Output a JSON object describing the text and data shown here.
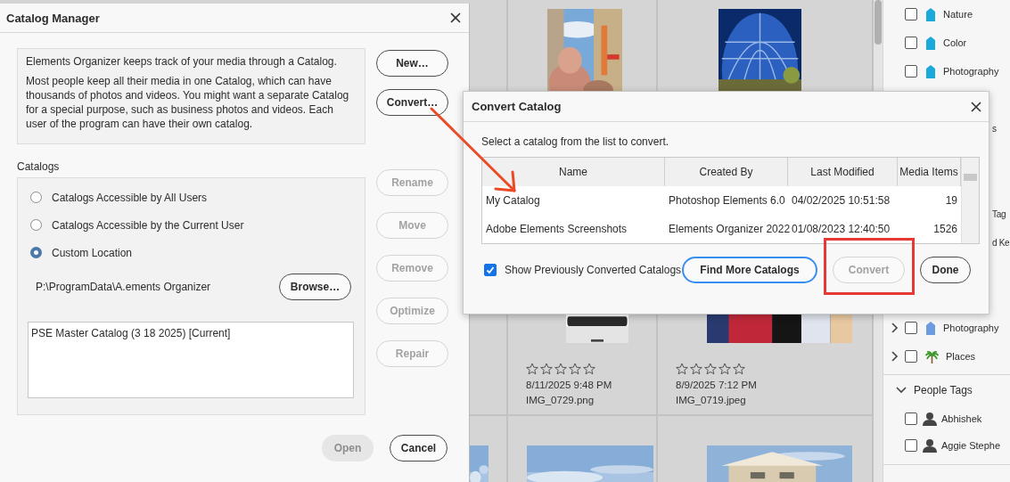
{
  "catalog_manager": {
    "title": "Catalog Manager",
    "intro": [
      "Elements Organizer keeps track of your media through a Catalog.",
      "Most people keep all their media in one Catalog, which can have thousands of photos and videos. You might want a separate Catalog for a special purpose, such as business photos and videos. Each user of the program can have their own catalog."
    ],
    "top_buttons": [
      {
        "label": "New…",
        "disabled": false
      },
      {
        "label": "Convert…",
        "disabled": false
      }
    ],
    "catalogs_label": "Catalogs",
    "locations": [
      {
        "label": "Catalogs Accessible by All Users",
        "selected": false
      },
      {
        "label": "Catalogs Accessible by the Current User",
        "selected": false
      },
      {
        "label": "Custom Location",
        "selected": true
      }
    ],
    "path": "P:\\ProgramData\\A.ements Organizer",
    "browse_button": "Browse…",
    "catalog_list": [
      "PSE Master Catalog (3 18 2025) [Current]"
    ],
    "catalog_buttons": [
      {
        "label": "Rename",
        "disabled": true
      },
      {
        "label": "Move",
        "disabled": true
      },
      {
        "label": "Remove",
        "disabled": true
      },
      {
        "label": "Optimize",
        "disabled": true
      },
      {
        "label": "Repair",
        "disabled": true
      }
    ],
    "footer_buttons": [
      {
        "label": "Open",
        "kind": "fill",
        "disabled": true
      },
      {
        "label": "Cancel",
        "kind": "outline",
        "disabled": false
      }
    ]
  },
  "media_grid": {
    "rows": [
      [
        {
          "thumbnail": {
            "kind": "picture"
          }
        },
        {
          "thumbnail": {
            "kind": "picture"
          }
        }
      ],
      [
        {
          "thumbnail": {
            "kind": "picture"
          },
          "stars": 0,
          "date": "8/11/2025 9:48 PM",
          "filename": "IMG_0729.png"
        },
        {
          "thumbnail": {
            "kind": "picture"
          },
          "stars": 0,
          "date": "8/9/2025 7:12 PM",
          "filename": "IMG_0719.jpeg"
        }
      ],
      [
        {
          "thumbnail": {
            "kind": "picture"
          }
        },
        {
          "thumbnail": {
            "kind": "picture"
          }
        },
        {
          "thumbnail": {
            "kind": "picture"
          }
        }
      ]
    ]
  },
  "tags_panel": {
    "items": [
      {
        "kind": "tag",
        "label": "Nature",
        "checked": false,
        "color": "#1aa9d9"
      },
      {
        "kind": "tag",
        "label": "Color",
        "checked": false,
        "color": "#1aa9d9"
      },
      {
        "kind": "tag",
        "label": "Photography",
        "checked": false,
        "color": "#1aa9d9"
      },
      {
        "kind": "fragment",
        "label": "s"
      },
      {
        "kind": "fragment",
        "label": "Tag"
      },
      {
        "kind": "fragment",
        "label": "d Ke"
      },
      {
        "kind": "category",
        "label": "Photography",
        "checked": false,
        "expanded": false,
        "color": "#6c9be0"
      },
      {
        "kind": "place",
        "label": "Places",
        "checked": false,
        "expanded": false
      }
    ],
    "people_tags": {
      "label": "People Tags",
      "expanded": true,
      "people": [
        {
          "label": "Abhishek",
          "checked": false
        },
        {
          "label": "Aggie Stephe",
          "checked": false
        }
      ]
    }
  },
  "convert_catalog": {
    "title": "Convert Catalog",
    "instruction": "Select a catalog from the list to convert.",
    "table": {
      "columns": [
        "Name",
        "Created By",
        "Last Modified",
        "Media Items"
      ],
      "rows": [
        [
          "My Catalog",
          "Photoshop Elements 6.0",
          "04/02/2025 10:51:58",
          "19"
        ],
        [
          "Adobe Elements Screenshots",
          "Elements Organizer 2022",
          "01/08/2023 12:40:50",
          "1526"
        ]
      ]
    },
    "show_previous": {
      "label": "Show Previously Converted Catalogs",
      "checked": true
    },
    "buttons": [
      {
        "label": "Find More Catalogs",
        "focused": true,
        "disabled": false
      },
      {
        "label": "Convert",
        "focused": false,
        "disabled": true
      },
      {
        "label": "Done",
        "focused": false,
        "disabled": false
      }
    ]
  }
}
